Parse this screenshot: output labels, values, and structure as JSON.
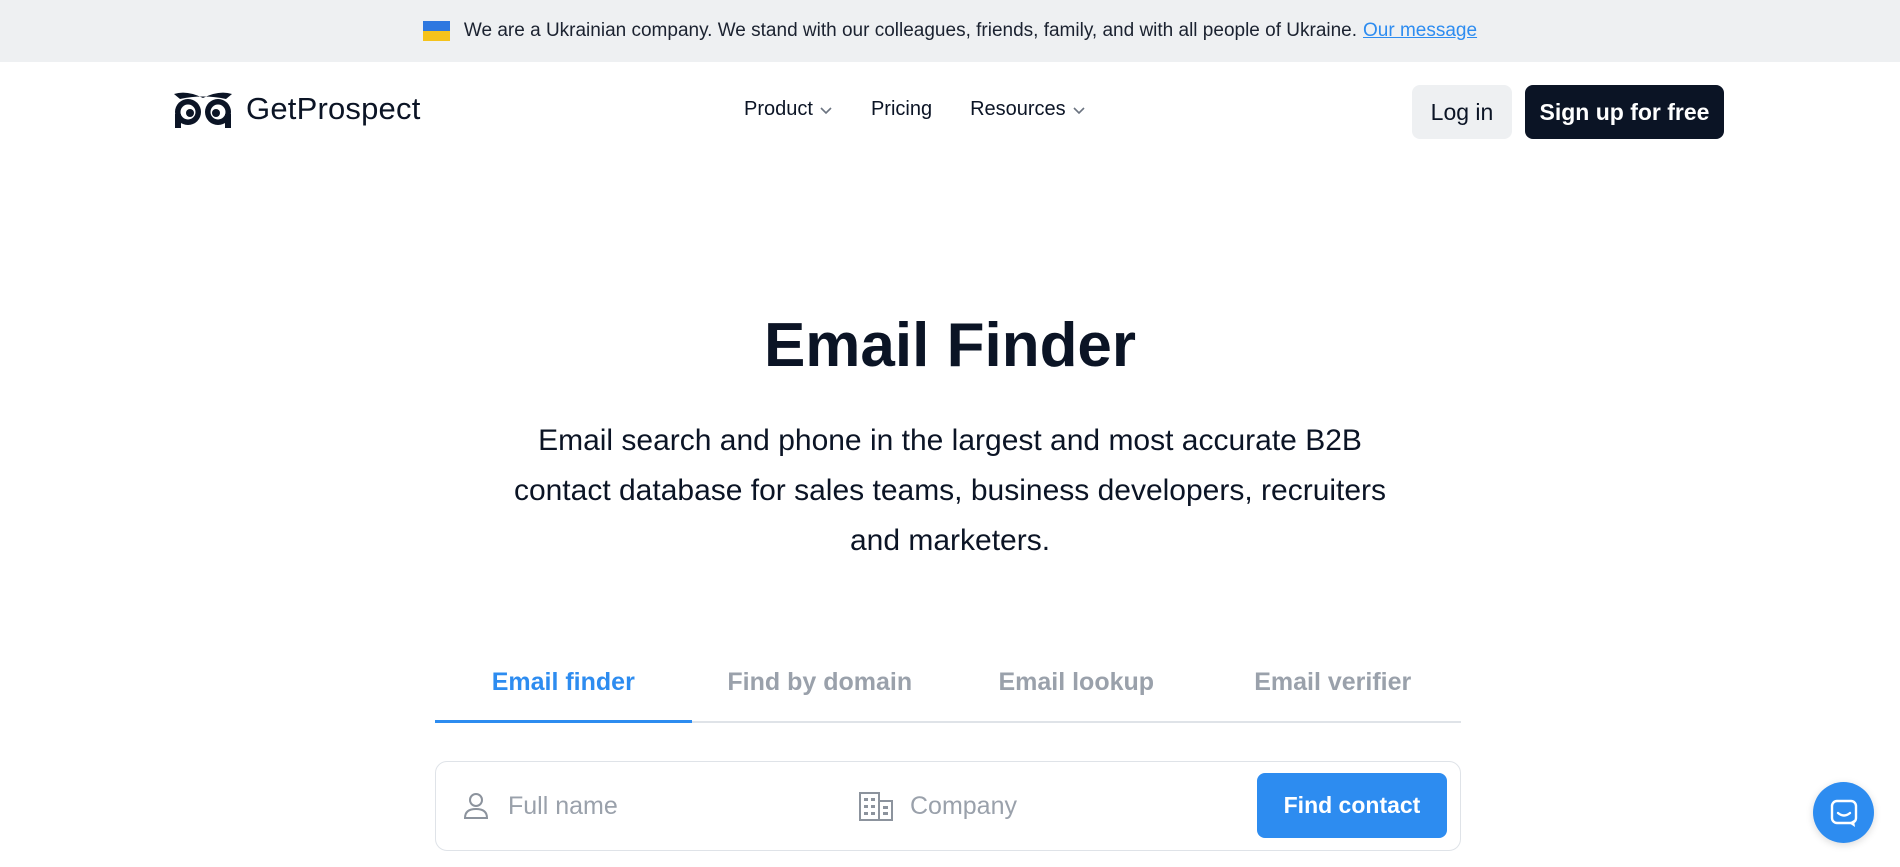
{
  "banner": {
    "flag_icon": "ukraine-flag-icon",
    "text": "We are a Ukrainian company. We stand with our colleagues, friends, family, and with all people of Ukraine.",
    "link_label": "Our message"
  },
  "header": {
    "logo_text": "GetProspect",
    "nav": [
      {
        "label": "Product",
        "has_dropdown": true
      },
      {
        "label": "Pricing",
        "has_dropdown": false
      },
      {
        "label": "Resources",
        "has_dropdown": true
      }
    ],
    "login_label": "Log in",
    "signup_label": "Sign up for free"
  },
  "hero": {
    "title": "Email Finder",
    "subtitle": "Email search and phone in the largest and most accurate B2B contact database for sales teams, business developers, recruiters and marketers."
  },
  "tabs": [
    {
      "label": "Email finder",
      "active": true
    },
    {
      "label": "Find by domain",
      "active": false
    },
    {
      "label": "Email lookup",
      "active": false
    },
    {
      "label": "Email verifier",
      "active": false
    }
  ],
  "search": {
    "fullname_placeholder": "Full name",
    "company_placeholder": "Company",
    "submit_label": "Find contact"
  },
  "colors": {
    "accent": "#2d8cf0",
    "dark": "#0b1425",
    "muted": "#9aa1ab",
    "banner_bg": "#eef0f2"
  }
}
